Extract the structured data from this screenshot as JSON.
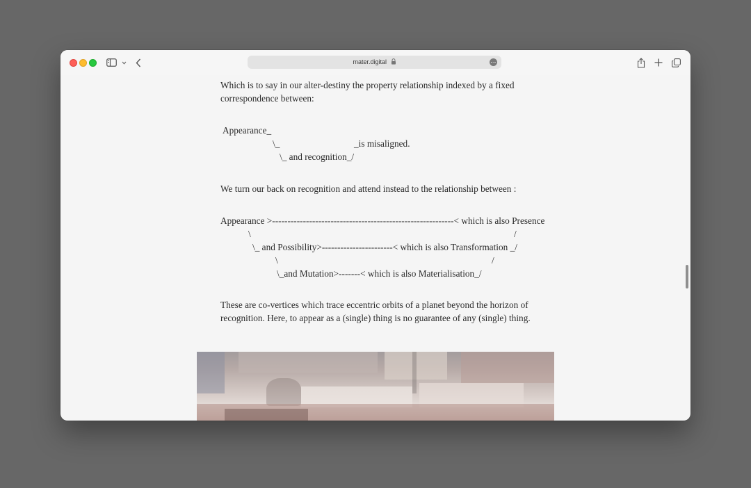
{
  "browser": {
    "url": "mater.digital",
    "icons": [
      "sidebar-icon",
      "chevron-down-icon",
      "back-icon",
      "lock-icon",
      "more-icon",
      "share-icon",
      "plus-icon",
      "tabs-icon"
    ]
  },
  "article": {
    "p1": {
      "line1": "Which is to say in our alter-destiny the property relationship indexed by a fixed",
      "line2": "correspondence between:"
    },
    "diagram1": {
      "l1": "Appearance_",
      "l2a": "\\_",
      "l2b": "_is misaligned.",
      "l3": "\\_ and recognition_/"
    },
    "p2": "We turn our back on recognition and attend instead to the relationship between :",
    "diagram2": {
      "l1": "Appearance >-----------------------------------------------------------< which is also Presence",
      "l2a": "\\",
      "l2b": "/",
      "l3": "\\_ and Possibility>-----------------------< which is also Transformation _/",
      "l4a": "\\",
      "l4b": "/",
      "l5": "\\_and Mutation>-------< which is also Materialisation_/"
    },
    "p3": {
      "line1": "These are co-vertices which trace eccentric orbits of a planet beyond the horizon of",
      "line2": "recognition. Here, to appear as a (single) thing is no guarantee of any (single) thing."
    }
  },
  "colors": {
    "desktop": "#676767",
    "page": "#f5f5f5",
    "text": "#2b2b2b"
  }
}
